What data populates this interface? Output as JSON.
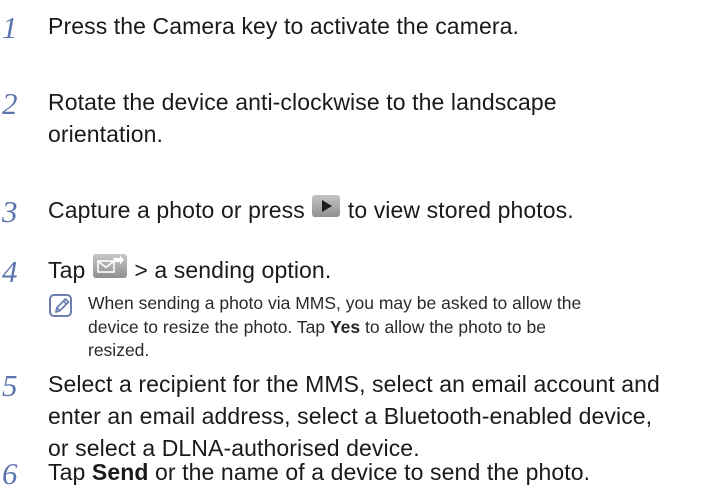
{
  "steps": [
    {
      "number": "1",
      "text": "Press the Camera key to activate the camera."
    },
    {
      "number": "2",
      "line1": "Rotate the device anti-clockwise to the landscape",
      "line2": "orientation."
    },
    {
      "number": "3",
      "before_icon": "Capture a photo or press",
      "icon": "play-icon",
      "after_icon": "to view stored photos."
    },
    {
      "number": "4",
      "before_icon": "Tap",
      "icon": "send-message-icon",
      "after_icon": "> a sending option."
    },
    {
      "number": "5",
      "line1": "Select a recipient for the MMS, select an email account and",
      "line2": "enter an email address, select a Bluetooth-enabled device,",
      "line3": "or select a DLNA-authorised device."
    },
    {
      "number": "6",
      "before_bold": "Tap",
      "bold": "Send",
      "after_bold": "or the name of a device to send the photo."
    }
  ],
  "note": {
    "icon": "note-pencil-icon",
    "line1": "When sending a photo via MMS, you may be asked to allow the",
    "line2_before": "device to resize the photo. Tap",
    "line2_bold": "Yes",
    "line2_after": "to allow the photo to be",
    "line3": "resized."
  },
  "colors": {
    "step_number": "#5b74ad",
    "icon_background": "#a8a8a8"
  }
}
